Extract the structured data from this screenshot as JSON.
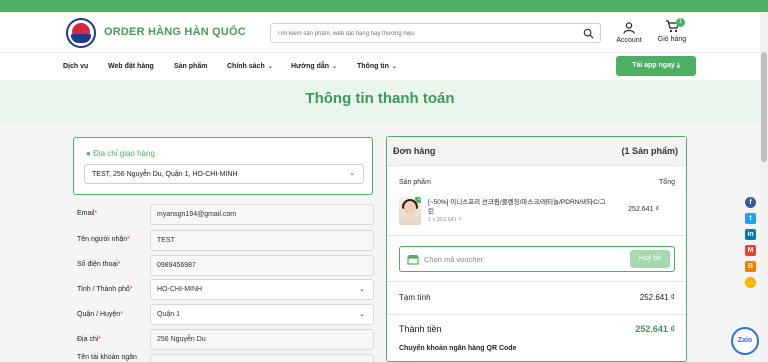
{
  "brand": {
    "name": "ORDER HÀNG HÀN QUỐC"
  },
  "search": {
    "placeholder": "Tìm kiếm sản phẩm, web đặt hàng hay thương hiệu"
  },
  "header": {
    "account_label": "Account",
    "cart_label": "Giỏ hàng",
    "cart_count": "1"
  },
  "nav": {
    "items": [
      "Dịch vụ",
      "Web đặt hàng",
      "Sản phẩm",
      "Chính sách",
      "Hướng dẫn",
      "Thông tin"
    ],
    "app_button": "Tải app ngay"
  },
  "page": {
    "title": "Thông tin thanh toán"
  },
  "address": {
    "title": "Địa chỉ giao hàng",
    "selected": "TEST, 256 Nguyễn Du, Quận 1, HO-CHI-MINH"
  },
  "form": {
    "email": {
      "label": "Email",
      "value": "myansgn194@gmail.com"
    },
    "receiver": {
      "label": "Tên người nhận",
      "value": "TEST"
    },
    "phone": {
      "label": "Số điện thoại",
      "value": "0989456987"
    },
    "city": {
      "label": "Tỉnh / Thành phố",
      "value": "HO-CHI-MINH"
    },
    "district": {
      "label": "Quận / Huyện",
      "value": "Quận 1"
    },
    "address": {
      "label": "Địa chỉ",
      "value": "256 Nguyễn Du"
    },
    "account_name": {
      "label": "Tên tài khoản ngân"
    }
  },
  "order": {
    "title": "Đơn hàng",
    "count": "(1 Sản phẩm)",
    "col_product": "Sản phẩm",
    "col_total": "Tổng",
    "item": {
      "name": "[~50%] 이니스프리 선크림/클렌징/마스크/레티놀/PDRN/비타C/그린",
      "qty": "1 x 252.641 ₫",
      "price": "252.641 ₫",
      "qty_badge": "1"
    },
    "voucher_placeholder": "Chọn mã voucher",
    "voucher_button": "Huỷ bỏ",
    "subtotal_label": "Tạm tính",
    "subtotal": "252.641 ₫",
    "total_label": "Thành tiền",
    "total": "252.641 ₫",
    "payment_method": "Chuyển khoản ngân hàng QR Code"
  },
  "social": {
    "icons": [
      "facebook-icon",
      "twitter-icon",
      "linkedin-icon",
      "gmail-icon",
      "blogger-icon",
      "sms-icon"
    ]
  },
  "zalo": {
    "label": "Zalo"
  },
  "colors": {
    "primary": "#4caf63",
    "accent_text": "#3e9a56",
    "hero_bg": "#eaf5ee",
    "required": "#e53935"
  }
}
